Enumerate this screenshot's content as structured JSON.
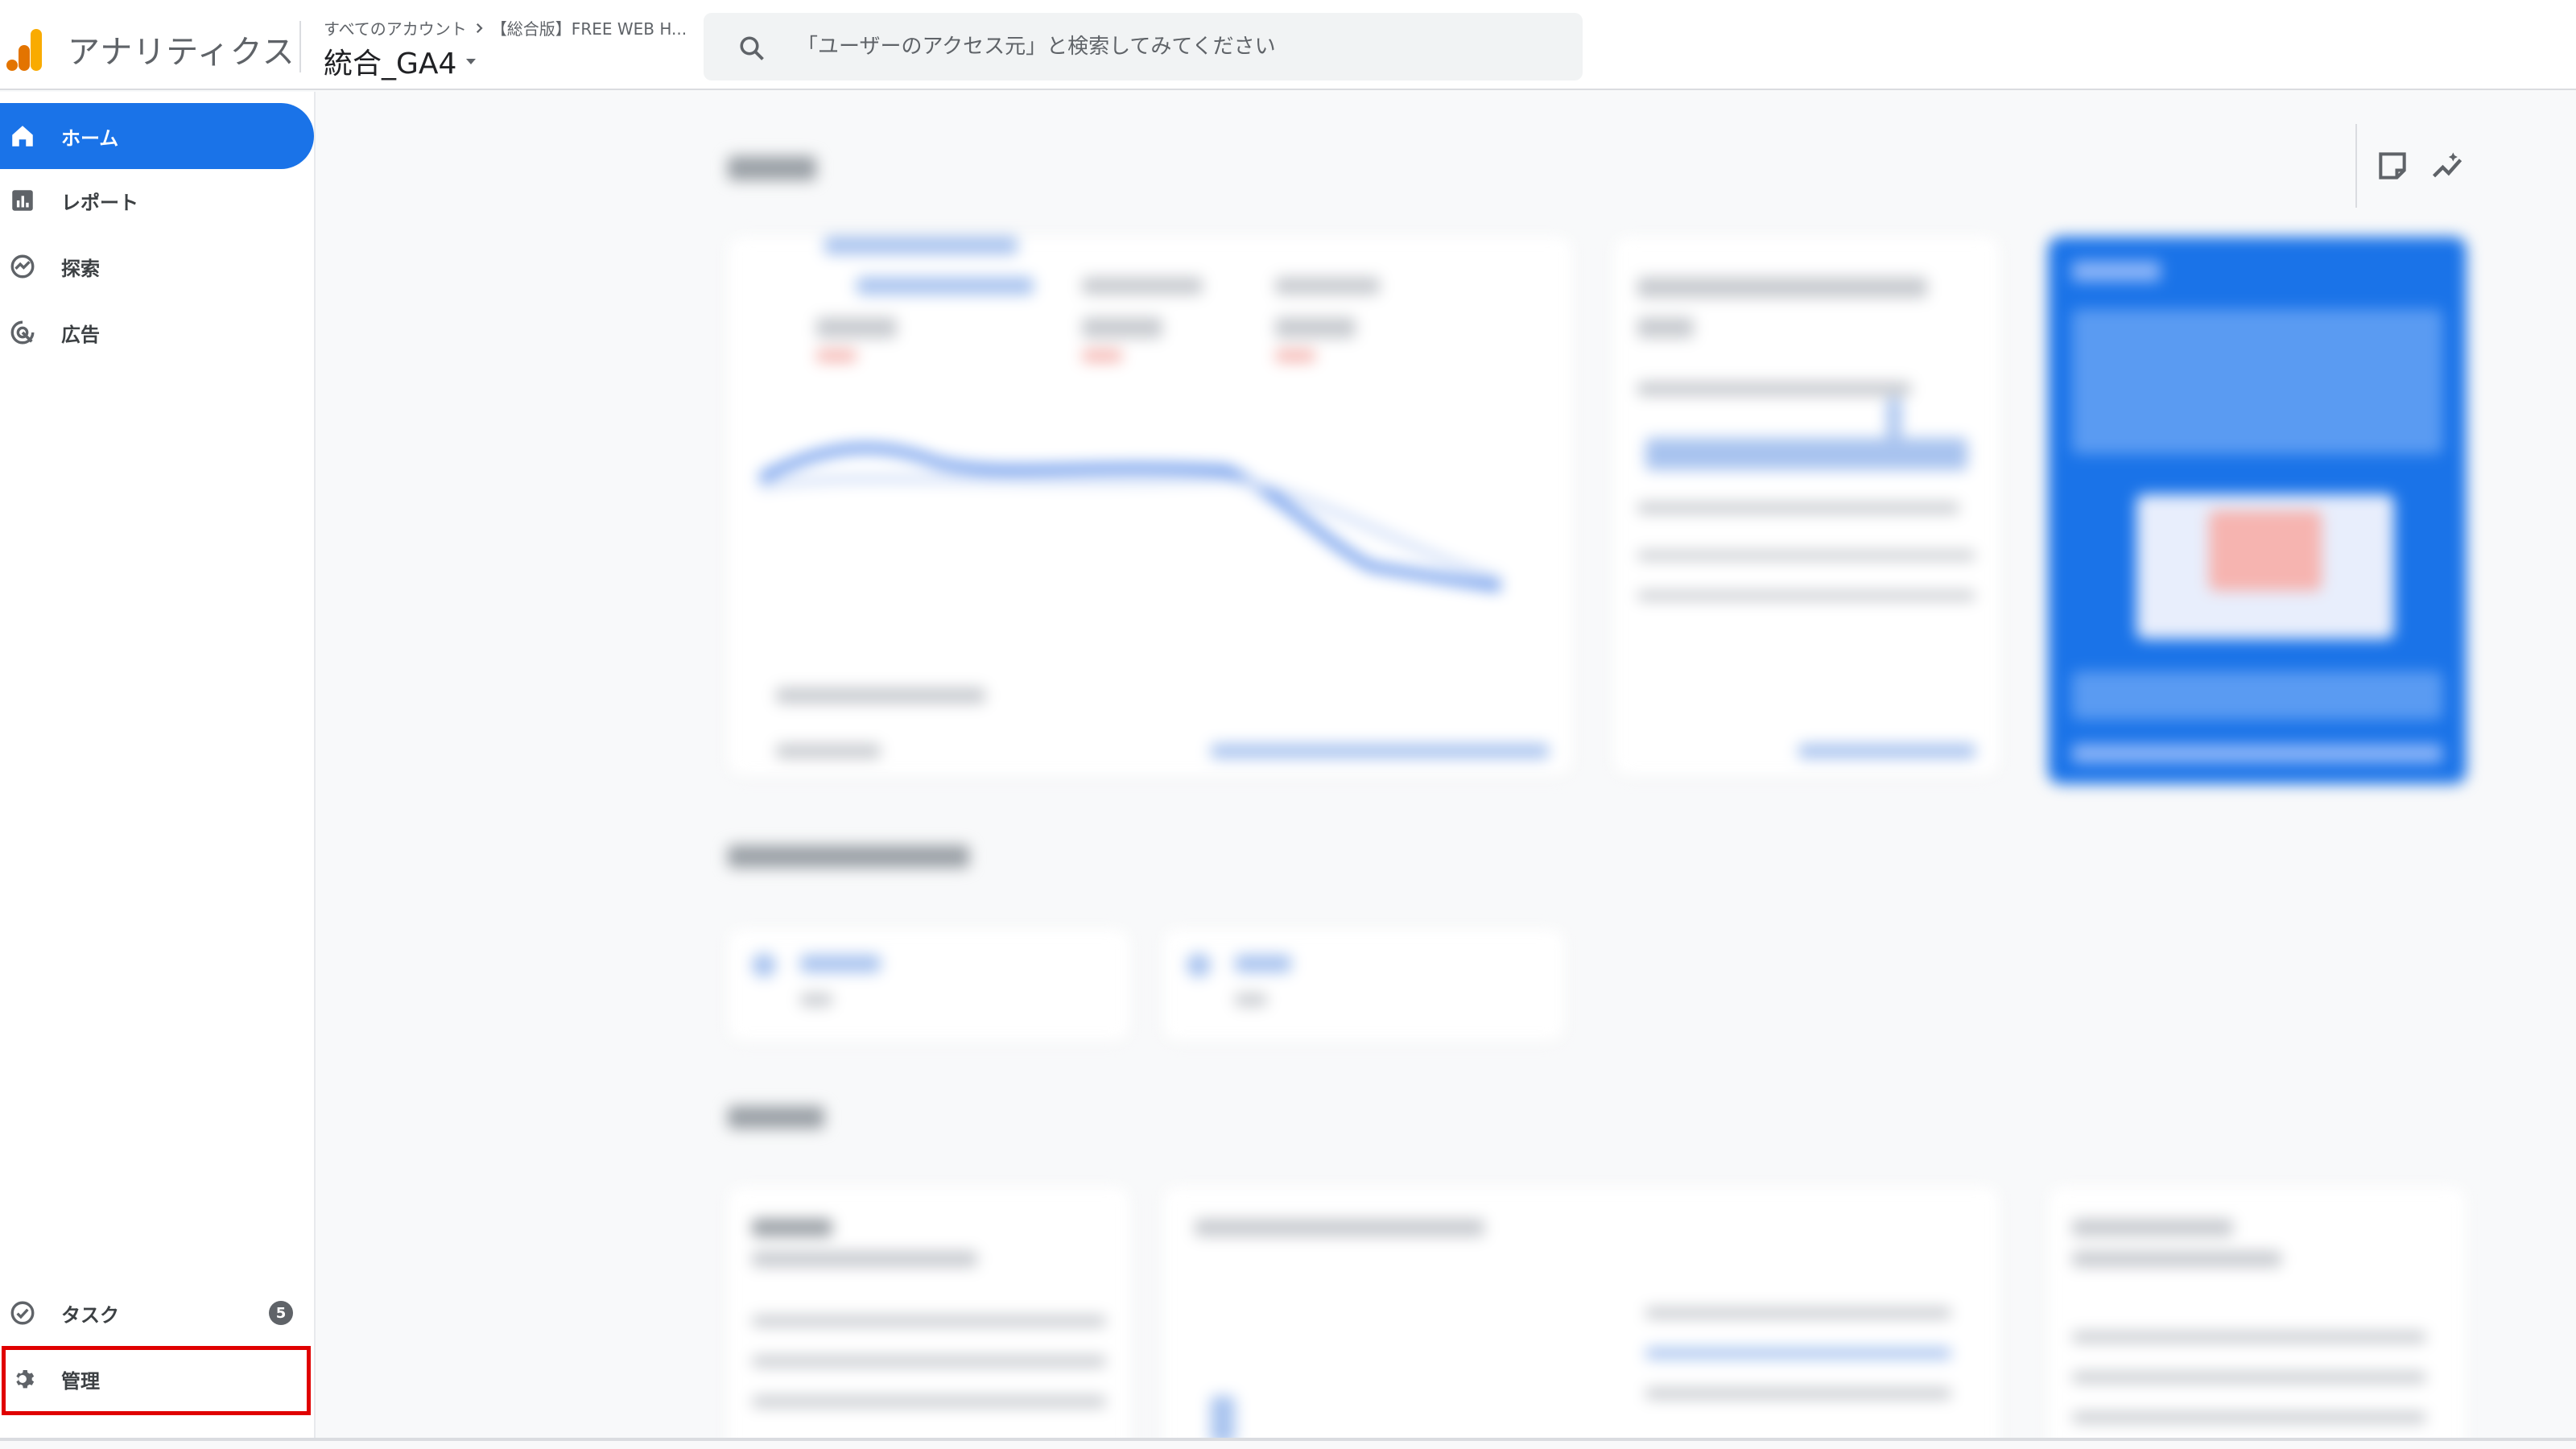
{
  "header": {
    "app_title": "アナリティクス",
    "breadcrumb_root": "すべてのアカウント",
    "breadcrumb_account": "【総合版】FREE WEB H...",
    "property_name": "統合_GA4",
    "search_placeholder": "「ユーザーのアクセス元」と検索してみてください"
  },
  "sidebar": {
    "items": [
      {
        "label": "ホーム",
        "icon": "home-icon",
        "active": true
      },
      {
        "label": "レポート",
        "icon": "reports-icon",
        "active": false
      },
      {
        "label": "探索",
        "icon": "explore-icon",
        "active": false
      },
      {
        "label": "広告",
        "icon": "advertising-icon",
        "active": false
      }
    ],
    "bottom_items": [
      {
        "label": "タスク",
        "icon": "tasks-icon",
        "badge": "5"
      },
      {
        "label": "管理",
        "icon": "gear-icon",
        "highlighted": true
      }
    ]
  },
  "colors": {
    "accent": "#1a73e8",
    "highlight": "#e00000",
    "logo_orange": "#f9ab00",
    "logo_dark_orange": "#e37400"
  }
}
